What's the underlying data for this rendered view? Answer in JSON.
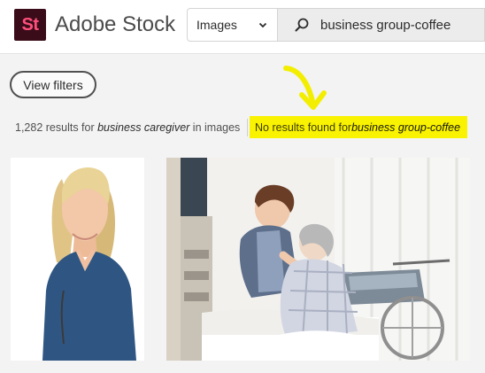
{
  "header": {
    "logo_mark": "St",
    "brand_name": "Adobe Stock",
    "type_select": {
      "value": "Images",
      "icon": "chevron-down-icon"
    },
    "search": {
      "value": "business group-coffee",
      "icon": "search-icon"
    }
  },
  "filters": {
    "button_label": "View filters"
  },
  "results": {
    "count_text": "1,282 results for ",
    "substituted_query": "business caregiver",
    "scope_text": " in images",
    "no_results_text": "No results found for ",
    "original_query": "business group-coffee"
  },
  "annotation": {
    "icon": "arrow-annotation-icon",
    "color": "#f3ee00"
  },
  "images": [
    {
      "subject": "smiling-nurse"
    },
    {
      "subject": "caregiver-helping-elderly-patient"
    }
  ],
  "colors": {
    "highlight": "#f9f200",
    "logo_bg": "#3a0c1a",
    "logo_fg": "#ff4f7b"
  }
}
